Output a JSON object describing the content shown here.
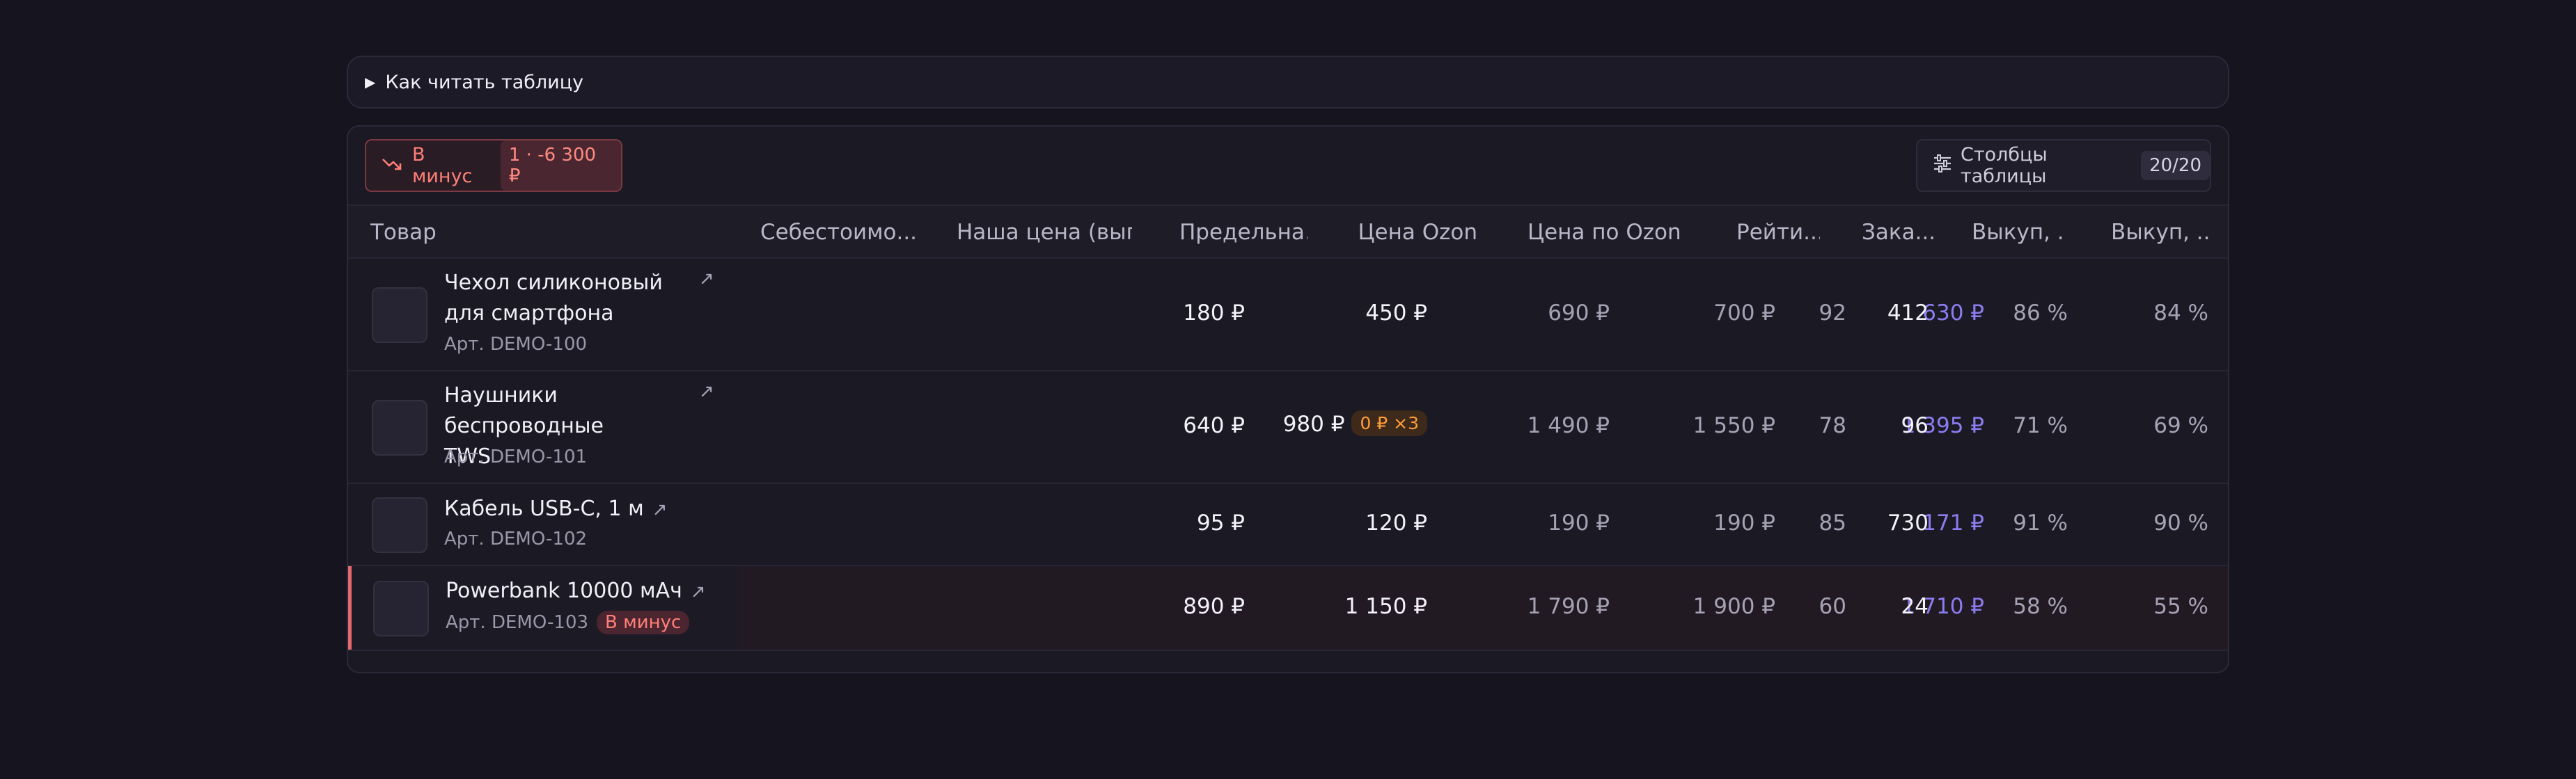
{
  "howto": {
    "label": "Как читать таблицу"
  },
  "toolbar": {
    "loss_label": "В минус",
    "loss_chip": "1 · -6 300 ₽",
    "columns_label": "Столбцы таблицы",
    "columns_count": "20/20"
  },
  "table": {
    "headers": [
      "Товар",
      "Себестоимо...",
      "Наша цена (вып...",
      "Предельна...",
      "Цена Ozon",
      "Цена по Ozon ...",
      "Рейти...",
      "Зака...",
      "Выкуп, ...",
      "Выкуп, ..."
    ],
    "rows": [
      {
        "name": "Чехол силиконовый для смартфона",
        "sku": "Арт. DEMO-100",
        "cost": "180 ₽",
        "our_price": "450 ₽",
        "limit": "690 ₽",
        "ozon_price": "700 ₽",
        "ozon_card_price": "630 ₽",
        "rating": "92",
        "orders": "412",
        "buyout1": "86 %",
        "buyout2": "84 %"
      },
      {
        "name": "Наушники беспроводные TWS",
        "sku": "Арт. DEMO-101",
        "cost": "640 ₽",
        "our_price": "980 ₽",
        "our_price_badge": "0 ₽ ×3",
        "limit": "1 490 ₽",
        "ozon_price": "1 550 ₽",
        "ozon_card_price": "1 395 ₽",
        "rating": "78",
        "orders": "96",
        "buyout1": "71 %",
        "buyout2": "69 %"
      },
      {
        "name": "Кабель USB-C, 1 м",
        "sku": "Арт. DEMO-102",
        "cost": "95 ₽",
        "our_price": "120 ₽",
        "limit": "190 ₽",
        "ozon_price": "190 ₽",
        "ozon_card_price": "171 ₽",
        "rating": "85",
        "orders": "730",
        "buyout1": "91 %",
        "buyout2": "90 %"
      },
      {
        "name": "Powerbank 10000 мАч",
        "sku": "Арт. DEMO-103",
        "sku_tag": "В минус",
        "cost": "890 ₽",
        "our_price": "1 150 ₽",
        "limit": "1 790 ₽",
        "ozon_price": "1 900 ₽",
        "ozon_card_price": "1 710 ₽",
        "rating": "60",
        "orders": "24",
        "buyout1": "58 %",
        "buyout2": "55 %"
      }
    ]
  },
  "icons": {
    "expand": "triangle-right-icon",
    "loss": "trending-down-icon",
    "columns": "sliders-icon",
    "external": "external-link-icon"
  },
  "colors": {
    "background": "#16151f",
    "loss_red": "#ff7f78",
    "accent_purple": "#8b7cf0",
    "warning_orange": "#ff9d3a"
  }
}
